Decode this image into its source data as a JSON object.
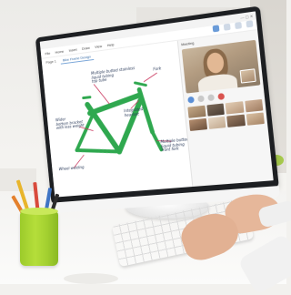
{
  "app": {
    "window_title": "",
    "menu": [
      "File",
      "Home",
      "Insert",
      "Draw",
      "View",
      "Help"
    ],
    "page_tabs": [
      "Page 1",
      "Bike Frame Design"
    ],
    "tab_selected": "Bike Frame Design"
  },
  "sketch": {
    "notes": [
      "Multiple butted stainless\nliquid tubing\ntop tube",
      "Fork",
      "Wider\nbottom bracket\nwith less weight",
      "Integrated\nheadset",
      "Multiple butted steel\nliquid tubing\nfront fork",
      "Wheel welding"
    ],
    "stroke_color": "#2fa84f",
    "annotation_color": "#c8325a"
  },
  "video_call": {
    "header": "Meeting"
  }
}
